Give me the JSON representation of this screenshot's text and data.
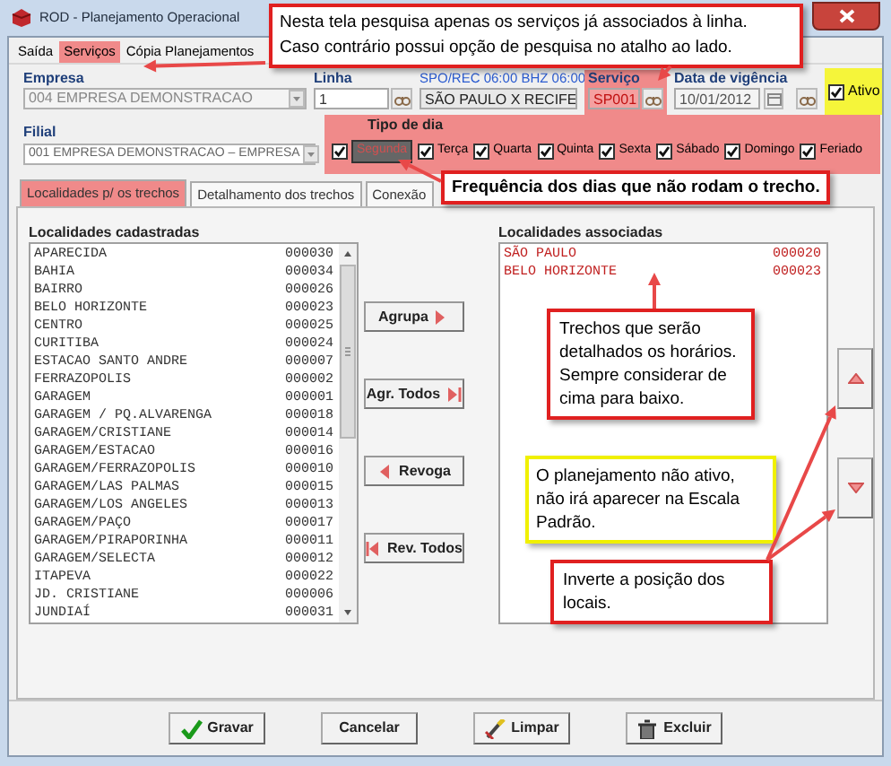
{
  "window": {
    "title": "ROD - Planejamento Operacional"
  },
  "menu": [
    {
      "label": "Saída",
      "highlighted": false
    },
    {
      "label": "Serviços",
      "highlighted": true
    },
    {
      "label": "Cópia Planejamentos",
      "highlighted": false
    }
  ],
  "empresa": {
    "label": "Empresa",
    "value": "004 EMPRESA DEMONSTRACAO"
  },
  "linha": {
    "label": "Linha",
    "value": "1",
    "route": "SPO/REC 06:00 BHZ 06:00",
    "description": "SÃO PAULO X RECIFE"
  },
  "servico": {
    "label": "Serviço",
    "value": "SP001",
    "highlighted": true
  },
  "data_vigencia": {
    "label": "Data de vigência",
    "value": "10/01/2012"
  },
  "ativo": {
    "label": "Ativo",
    "checked": true,
    "highlighted": true
  },
  "filial": {
    "label": "Filial",
    "value": "001 EMPRESA DEMONSTRACAO – EMPRESA"
  },
  "tipo_de_dia": {
    "label": "Tipo de dia",
    "highlighted": true,
    "days": [
      {
        "label": "Segunda",
        "checked": true,
        "focused": true
      },
      {
        "label": "Terça",
        "checked": true,
        "focused": false
      },
      {
        "label": "Quarta",
        "checked": true,
        "focused": false
      },
      {
        "label": "Quinta",
        "checked": true,
        "focused": false
      },
      {
        "label": "Sexta",
        "checked": true,
        "focused": false
      },
      {
        "label": "Sábado",
        "checked": true,
        "focused": false
      },
      {
        "label": "Domingo",
        "checked": true,
        "focused": false
      },
      {
        "label": "Feriado",
        "checked": true,
        "focused": false
      }
    ]
  },
  "tabs": [
    {
      "label": "Localidades p/ os trechos",
      "selected": true
    },
    {
      "label": "Detalhamento dos trechos",
      "selected": false
    },
    {
      "label": "Conexão",
      "selected": false
    }
  ],
  "localidades_cadastradas": {
    "label": "Localidades cadastradas",
    "rows": [
      {
        "name": "APARECIDA",
        "code": "000030"
      },
      {
        "name": "BAHIA",
        "code": "000034"
      },
      {
        "name": "BAIRRO",
        "code": "000026"
      },
      {
        "name": "BELO HORIZONTE",
        "code": "000023"
      },
      {
        "name": "CENTRO",
        "code": "000025"
      },
      {
        "name": "CURITIBA",
        "code": "000024"
      },
      {
        "name": "ESTACAO SANTO ANDRE",
        "code": "000007"
      },
      {
        "name": "FERRAZOPOLIS",
        "code": "000002"
      },
      {
        "name": "GARAGEM",
        "code": "000001"
      },
      {
        "name": "GARAGEM / PQ.ALVARENGA",
        "code": "000018"
      },
      {
        "name": "GARAGEM/CRISTIANE",
        "code": "000014"
      },
      {
        "name": "GARAGEM/ESTACAO",
        "code": "000016"
      },
      {
        "name": "GARAGEM/FERRAZOPOLIS",
        "code": "000010"
      },
      {
        "name": "GARAGEM/LAS PALMAS",
        "code": "000015"
      },
      {
        "name": "GARAGEM/LOS ANGELES",
        "code": "000013"
      },
      {
        "name": "GARAGEM/PAÇO",
        "code": "000017"
      },
      {
        "name": "GARAGEM/PIRAPORINHA",
        "code": "000011"
      },
      {
        "name": "GARAGEM/SELECTA",
        "code": "000012"
      },
      {
        "name": "ITAPEVA",
        "code": "000022"
      },
      {
        "name": "JD. CRISTIANE",
        "code": "000006"
      },
      {
        "name": "JUNDIAÍ",
        "code": "000031"
      }
    ]
  },
  "localidades_associadas": {
    "label": "Localidades associadas",
    "rows": [
      {
        "name": "SÃO PAULO",
        "code": "000020"
      },
      {
        "name": "BELO HORIZONTE",
        "code": "000023"
      }
    ]
  },
  "transfer_buttons": [
    {
      "label": "Agrupa",
      "kind": "add"
    },
    {
      "label": "Agr. Todos",
      "kind": "add_all"
    },
    {
      "label": "Revoga",
      "kind": "remove"
    },
    {
      "label": "Rev. Todos",
      "kind": "remove_all"
    }
  ],
  "order_buttons": [
    {
      "kind": "up"
    },
    {
      "kind": "down"
    }
  ],
  "footer_buttons": [
    {
      "label": "Gravar",
      "kind": "save"
    },
    {
      "label": "Cancelar",
      "kind": "cancel"
    },
    {
      "label": "Limpar",
      "kind": "clear"
    },
    {
      "label": "Excluir",
      "kind": "delete"
    }
  ],
  "annotations": [
    {
      "lines": [
        "Nesta tela pesquisa apenas os serviços já associados à linha.",
        "Caso contrário possui opção de pesquisa no atalho ao lado."
      ],
      "color": "#e02020"
    },
    {
      "lines": [
        "Frequência dos dias que não rodam o trecho."
      ],
      "color": "#e02020"
    },
    {
      "lines": [
        "Trechos que serão detalhados os horários. Sempre considerar de cima para baixo."
      ],
      "color": "#e02020"
    },
    {
      "lines": [
        "O planejamento não ativo, não irá aparecer na Escala Padrão."
      ],
      "color": "#f0f000"
    },
    {
      "lines": [
        "Inverte a posição dos locais."
      ],
      "color": "#e02020"
    }
  ]
}
